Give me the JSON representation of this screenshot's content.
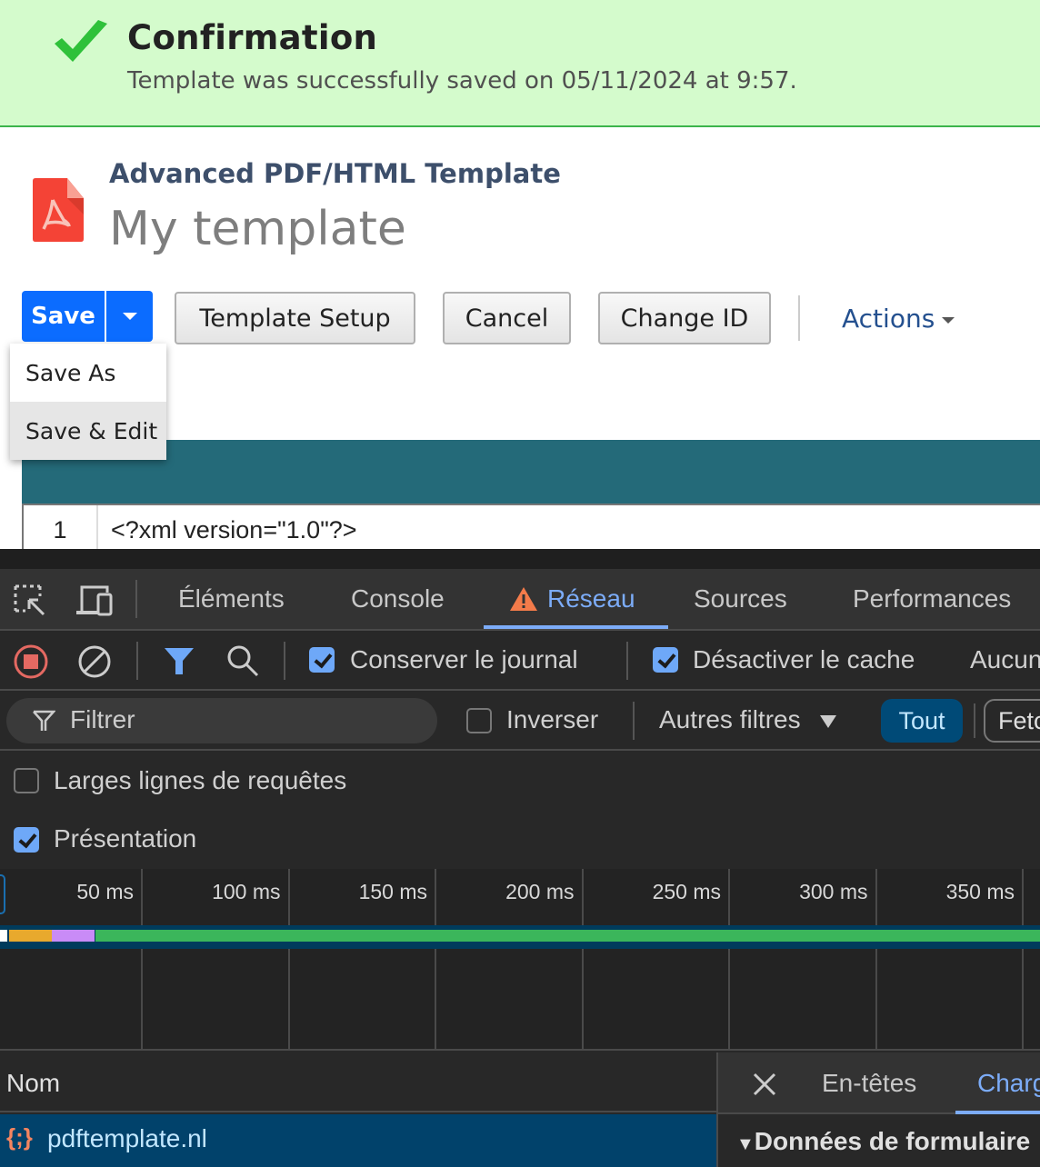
{
  "confirmation": {
    "icon": "checkmark-icon",
    "title": "Confirmation",
    "message": "Template was successfully saved on 05/11/2024 at 9:57."
  },
  "record": {
    "icon": "pdf-file-icon",
    "type": "Advanced PDF/HTML Template",
    "name": "My template"
  },
  "toolbar": {
    "save_label": "Save",
    "template_setup_label": "Template Setup",
    "cancel_label": "Cancel",
    "change_id_label": "Change ID",
    "actions_label": "Actions"
  },
  "save_menu": {
    "items": [
      {
        "label": "Save As",
        "highlighted": false
      },
      {
        "label": "Save & Edit",
        "highlighted": true
      }
    ]
  },
  "editor": {
    "lines": [
      {
        "number": "1",
        "code": "<?xml version=\"1.0\"?>"
      }
    ]
  },
  "devtools": {
    "tabs": [
      {
        "label": "Éléments",
        "active": false
      },
      {
        "label": "Console",
        "active": false
      },
      {
        "label": "Réseau",
        "active": true,
        "warning": true
      },
      {
        "label": "Sources",
        "active": false
      },
      {
        "label": "Performances",
        "active": false
      }
    ],
    "network_toolbar": {
      "preserve_log_label": "Conserver le journal",
      "preserve_log_checked": true,
      "disable_cache_label": "Désactiver le cache",
      "disable_cache_checked": true,
      "throttling_label": "Aucun"
    },
    "filter_bar": {
      "filter_placeholder": "Filtrer",
      "invert_label": "Inverser",
      "invert_checked": false,
      "more_filters_label": "Autres filtres",
      "type_all_label": "Tout",
      "type_fetch_label": "Fetch"
    },
    "options": {
      "large_rows_label": "Larges lignes de requêtes",
      "large_rows_checked": false,
      "overview_label": "Présentation",
      "overview_checked": true
    },
    "timeline": {
      "ticks": [
        "50 ms",
        "100 ms",
        "150 ms",
        "200 ms",
        "250 ms",
        "300 ms",
        "350 ms"
      ],
      "colors": {
        "queue": "#ffffff",
        "waiting": "#e8a92d",
        "connect": "#c98bf7",
        "download": "#3bb65b",
        "track": "#003b5c"
      }
    },
    "requests": {
      "name_header": "Nom",
      "rows": [
        {
          "name": "pdftemplate.nl",
          "icon": "script-braces-icon",
          "selected": true
        }
      ]
    },
    "details": {
      "close_icon": "close-icon",
      "tabs": [
        {
          "label": "En-têtes",
          "active": false
        },
        {
          "label": "Charge utile",
          "active": true
        }
      ],
      "section_title": "Données de formulaire"
    }
  }
}
